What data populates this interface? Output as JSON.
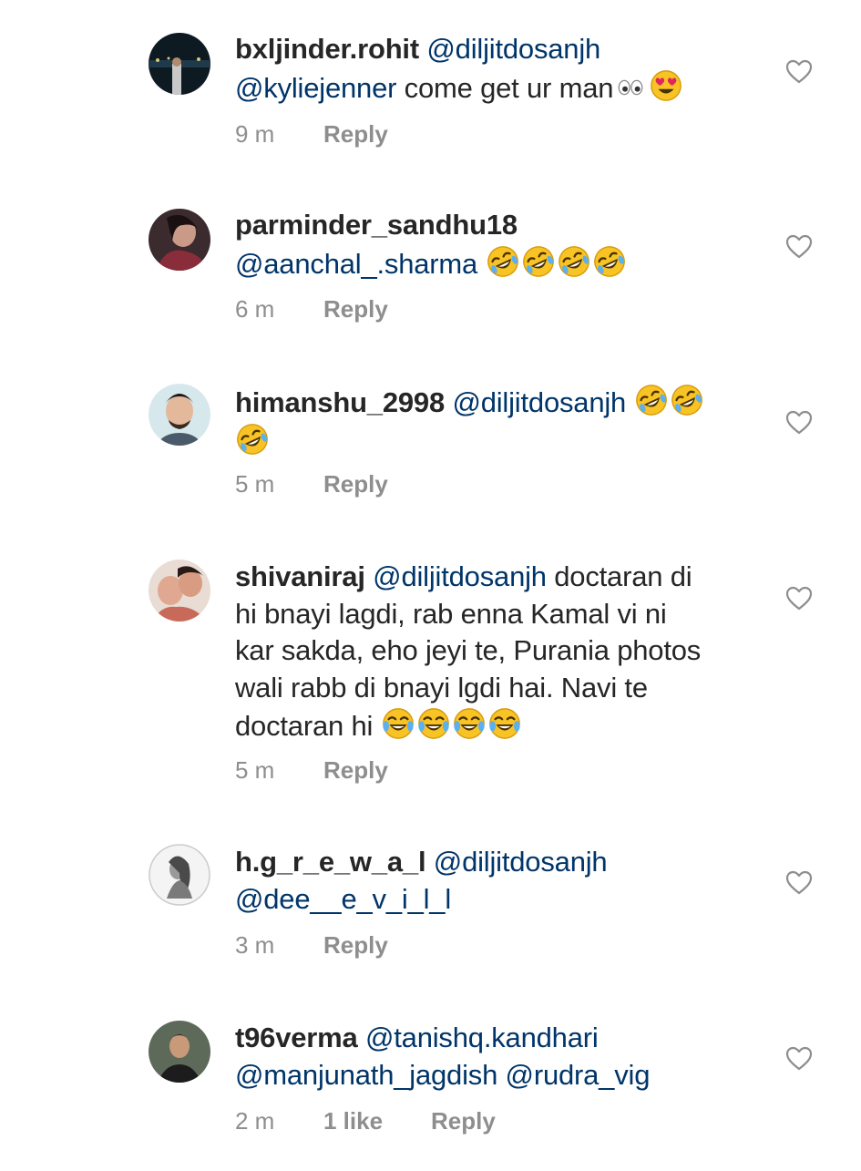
{
  "comments": [
    {
      "username": "bxljinder.rohit",
      "line1": [
        "@diljitdosanjh"
      ],
      "line2": [
        "@kyliejenner"
      ],
      "text_after": " come get ur man",
      "emojis": [
        "eyes",
        "heart-eyes"
      ],
      "time": "9 m",
      "reply": "Reply"
    },
    {
      "username": "parminder_sandhu18",
      "mention": "@aanchal_.sharma",
      "emojis": [
        "rofl",
        "rofl",
        "rofl",
        "rofl"
      ],
      "time": "6 m",
      "reply": "Reply"
    },
    {
      "username": "himanshu_2998",
      "mention": "@diljitdosanjh",
      "emojis": [
        "rofl",
        "rofl",
        "rofl"
      ],
      "time": "5 m",
      "reply": "Reply"
    },
    {
      "username": "shivaniraj",
      "mention": "@diljitdosanjh",
      "text_line1": " doctaran di",
      "text_line2": "hi bnayi lagdi, rab enna Kamal vi ni",
      "text_line3": "kar sakda, eho jeyi te, Purania photos",
      "text_line4": "wali rabb di bnayi lgdi hai. Navi te",
      "text_line5": "doctaran hi ",
      "emojis": [
        "tears-of-joy",
        "tears-of-joy",
        "tears-of-joy",
        "tears-of-joy"
      ],
      "time": "5 m",
      "reply": "Reply"
    },
    {
      "username": "h.g_r_e_w_a_l",
      "mention1": "@diljitdosanjh",
      "mention2": "@dee__e_v_i_l_l",
      "time": "3 m",
      "reply": "Reply"
    },
    {
      "username": "t96verma",
      "mention1": "@tanishq.kandhari",
      "mention2": "@manjunath_jagdish",
      "mention3": "@rudra_vig",
      "time": "2 m",
      "likes": "1 like",
      "reply": "Reply"
    }
  ],
  "icons": {
    "like": "heart-outline-icon",
    "avatar": "profile-photo"
  },
  "colors": {
    "username": "#262626",
    "mention": "#003569",
    "meta": "#8e8e8e",
    "heart": "#8e8e8e"
  }
}
